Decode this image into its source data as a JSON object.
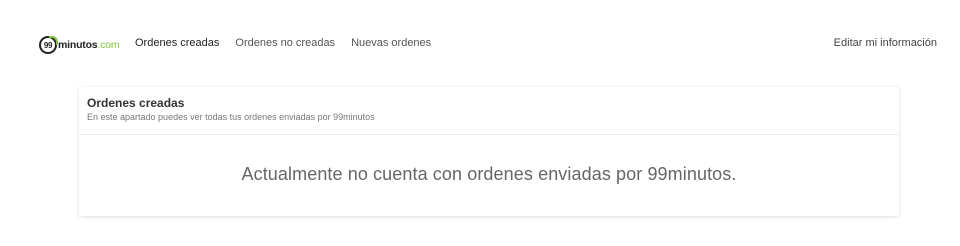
{
  "logo": {
    "badge": "99",
    "word": "minutos",
    "suffix": ".com",
    "accent_color": "#85c440"
  },
  "nav": {
    "items": [
      {
        "label": "Ordenes creadas",
        "active": true
      },
      {
        "label": "Ordenes no creadas",
        "active": false
      },
      {
        "label": "Nuevas ordenes",
        "active": false
      }
    ],
    "right_link": "Editar mi información"
  },
  "card": {
    "title": "Ordenes creadas",
    "subtitle": "En este apartado puedes ver todas tus ordenes enviadas por 99minutos",
    "empty_message": "Actualmente no cuenta con ordenes enviadas por 99minutos."
  }
}
